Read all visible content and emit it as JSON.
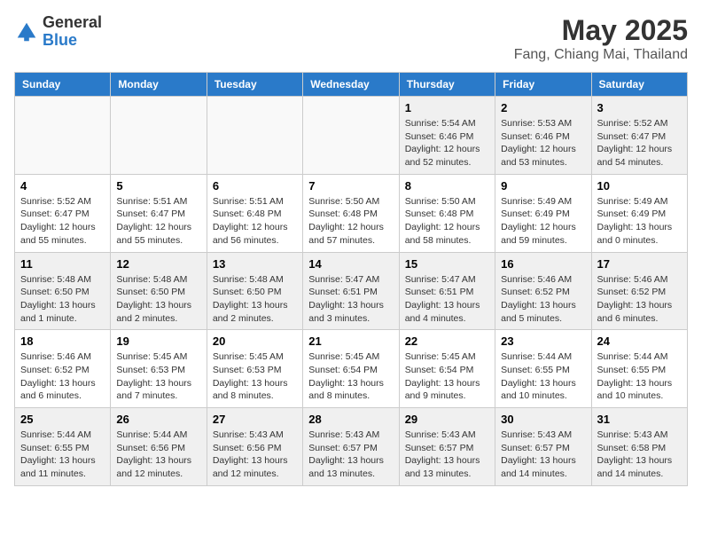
{
  "header": {
    "logo_general": "General",
    "logo_blue": "Blue",
    "month_title": "May 2025",
    "location": "Fang, Chiang Mai, Thailand"
  },
  "weekdays": [
    "Sunday",
    "Monday",
    "Tuesday",
    "Wednesday",
    "Thursday",
    "Friday",
    "Saturday"
  ],
  "weeks": [
    [
      {
        "day": "",
        "info": ""
      },
      {
        "day": "",
        "info": ""
      },
      {
        "day": "",
        "info": ""
      },
      {
        "day": "",
        "info": ""
      },
      {
        "day": "1",
        "info": "Sunrise: 5:54 AM\nSunset: 6:46 PM\nDaylight: 12 hours\nand 52 minutes."
      },
      {
        "day": "2",
        "info": "Sunrise: 5:53 AM\nSunset: 6:46 PM\nDaylight: 12 hours\nand 53 minutes."
      },
      {
        "day": "3",
        "info": "Sunrise: 5:52 AM\nSunset: 6:47 PM\nDaylight: 12 hours\nand 54 minutes."
      }
    ],
    [
      {
        "day": "4",
        "info": "Sunrise: 5:52 AM\nSunset: 6:47 PM\nDaylight: 12 hours\nand 55 minutes."
      },
      {
        "day": "5",
        "info": "Sunrise: 5:51 AM\nSunset: 6:47 PM\nDaylight: 12 hours\nand 55 minutes."
      },
      {
        "day": "6",
        "info": "Sunrise: 5:51 AM\nSunset: 6:48 PM\nDaylight: 12 hours\nand 56 minutes."
      },
      {
        "day": "7",
        "info": "Sunrise: 5:50 AM\nSunset: 6:48 PM\nDaylight: 12 hours\nand 57 minutes."
      },
      {
        "day": "8",
        "info": "Sunrise: 5:50 AM\nSunset: 6:48 PM\nDaylight: 12 hours\nand 58 minutes."
      },
      {
        "day": "9",
        "info": "Sunrise: 5:49 AM\nSunset: 6:49 PM\nDaylight: 12 hours\nand 59 minutes."
      },
      {
        "day": "10",
        "info": "Sunrise: 5:49 AM\nSunset: 6:49 PM\nDaylight: 13 hours\nand 0 minutes."
      }
    ],
    [
      {
        "day": "11",
        "info": "Sunrise: 5:48 AM\nSunset: 6:50 PM\nDaylight: 13 hours\nand 1 minute."
      },
      {
        "day": "12",
        "info": "Sunrise: 5:48 AM\nSunset: 6:50 PM\nDaylight: 13 hours\nand 2 minutes."
      },
      {
        "day": "13",
        "info": "Sunrise: 5:48 AM\nSunset: 6:50 PM\nDaylight: 13 hours\nand 2 minutes."
      },
      {
        "day": "14",
        "info": "Sunrise: 5:47 AM\nSunset: 6:51 PM\nDaylight: 13 hours\nand 3 minutes."
      },
      {
        "day": "15",
        "info": "Sunrise: 5:47 AM\nSunset: 6:51 PM\nDaylight: 13 hours\nand 4 minutes."
      },
      {
        "day": "16",
        "info": "Sunrise: 5:46 AM\nSunset: 6:52 PM\nDaylight: 13 hours\nand 5 minutes."
      },
      {
        "day": "17",
        "info": "Sunrise: 5:46 AM\nSunset: 6:52 PM\nDaylight: 13 hours\nand 6 minutes."
      }
    ],
    [
      {
        "day": "18",
        "info": "Sunrise: 5:46 AM\nSunset: 6:52 PM\nDaylight: 13 hours\nand 6 minutes."
      },
      {
        "day": "19",
        "info": "Sunrise: 5:45 AM\nSunset: 6:53 PM\nDaylight: 13 hours\nand 7 minutes."
      },
      {
        "day": "20",
        "info": "Sunrise: 5:45 AM\nSunset: 6:53 PM\nDaylight: 13 hours\nand 8 minutes."
      },
      {
        "day": "21",
        "info": "Sunrise: 5:45 AM\nSunset: 6:54 PM\nDaylight: 13 hours\nand 8 minutes."
      },
      {
        "day": "22",
        "info": "Sunrise: 5:45 AM\nSunset: 6:54 PM\nDaylight: 13 hours\nand 9 minutes."
      },
      {
        "day": "23",
        "info": "Sunrise: 5:44 AM\nSunset: 6:55 PM\nDaylight: 13 hours\nand 10 minutes."
      },
      {
        "day": "24",
        "info": "Sunrise: 5:44 AM\nSunset: 6:55 PM\nDaylight: 13 hours\nand 10 minutes."
      }
    ],
    [
      {
        "day": "25",
        "info": "Sunrise: 5:44 AM\nSunset: 6:55 PM\nDaylight: 13 hours\nand 11 minutes."
      },
      {
        "day": "26",
        "info": "Sunrise: 5:44 AM\nSunset: 6:56 PM\nDaylight: 13 hours\nand 12 minutes."
      },
      {
        "day": "27",
        "info": "Sunrise: 5:43 AM\nSunset: 6:56 PM\nDaylight: 13 hours\nand 12 minutes."
      },
      {
        "day": "28",
        "info": "Sunrise: 5:43 AM\nSunset: 6:57 PM\nDaylight: 13 hours\nand 13 minutes."
      },
      {
        "day": "29",
        "info": "Sunrise: 5:43 AM\nSunset: 6:57 PM\nDaylight: 13 hours\nand 13 minutes."
      },
      {
        "day": "30",
        "info": "Sunrise: 5:43 AM\nSunset: 6:57 PM\nDaylight: 13 hours\nand 14 minutes."
      },
      {
        "day": "31",
        "info": "Sunrise: 5:43 AM\nSunset: 6:58 PM\nDaylight: 13 hours\nand 14 minutes."
      }
    ]
  ]
}
